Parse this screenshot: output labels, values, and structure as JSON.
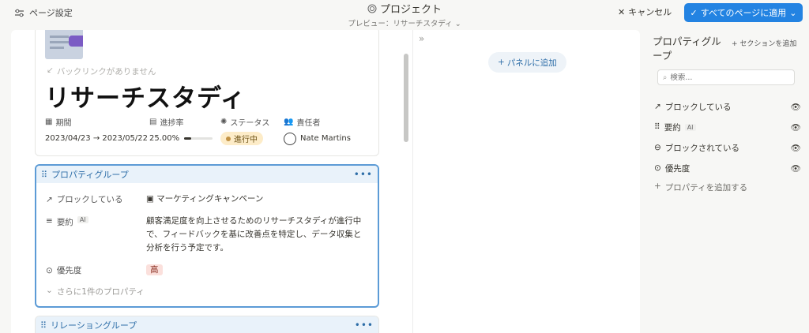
{
  "topbar": {
    "page_settings": "ページ設定",
    "title": "プロジェクト",
    "preview": "プレビュー：リサーチスタディ",
    "cancel": "キャンセル",
    "apply_all": "すべてのページに適用"
  },
  "page": {
    "backlinks": "バックリンクがありません",
    "title": "リサーチスタディ",
    "properties": {
      "period_label": "期間",
      "progress_label": "進捗率",
      "status_label": "ステータス",
      "assignee_label": "責任者",
      "period_value": "2023/04/23 → 2023/05/22",
      "progress_value": "25.00%",
      "progress_fraction": 0.25,
      "status_value": "進行中",
      "assignee_value": "Nate Martins"
    }
  },
  "property_group": {
    "title": "プロパティグループ",
    "rows": [
      {
        "label": "ブロックしている",
        "value": "マーケティングキャンペーン"
      },
      {
        "label": "要約",
        "ai": "AI",
        "value": "顧客満足度を向上させるためのリサーチスタディが進行中で、フィードバックを基に改善点を特定し、データ収集と分析を行う予定です。"
      },
      {
        "label": "優先度",
        "value": "高"
      }
    ],
    "more": "さらに1件のプロパティ"
  },
  "relation_group": {
    "title": "リレーショングループ"
  },
  "panel": {
    "add_panel": "パネルに追加"
  },
  "sidebar": {
    "title": "プロパティグループ",
    "add_section": "セクションを追加",
    "search_placeholder": "検索...",
    "items": [
      {
        "label": "ブロックしている",
        "icon": "arrow-up-right-icon"
      },
      {
        "label": "要約",
        "ai": "AI",
        "icon": "text-lines-icon"
      },
      {
        "label": "ブロックされている",
        "icon": "blocked-icon"
      },
      {
        "label": "優先度",
        "icon": "priority-icon"
      }
    ],
    "add_property": "プロパティを追加する"
  },
  "colors": {
    "accent": "#2383e2",
    "group_border": "#5c9bd6",
    "status_bg": "#fdecc8",
    "priority_bg": "#fbe0dc"
  }
}
